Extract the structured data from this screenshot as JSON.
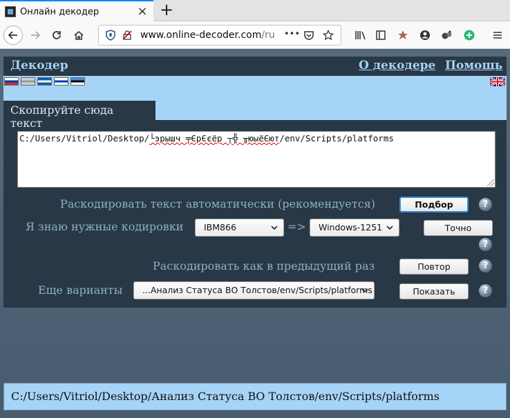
{
  "browser": {
    "tab_title": "Онлайн декодер",
    "tab_close": "×",
    "new_tab": "+",
    "url_host": "www.online-decoder.com",
    "url_path": "/ru",
    "url_more": "•••"
  },
  "header": {
    "title": "Декодер",
    "about_link": "О декодере",
    "help_link": "Помощь"
  },
  "languages": [
    {
      "name": "russian-flag-icon",
      "colors": [
        "#ffffff",
        "#0039a6",
        "#d52b1e"
      ]
    },
    {
      "name": "belarus-flag-icon",
      "colors": [
        "#d0d0d0",
        "#9a9a9a",
        "#d0d0d0"
      ]
    },
    {
      "name": "greek-flag-icon",
      "colors": [
        "#0d5eaf",
        "#ffffff",
        "#0d5eaf"
      ]
    },
    {
      "name": "israel-flag-icon",
      "colors": [
        "#ffffff",
        "#0038b8",
        "#ffffff"
      ]
    },
    {
      "name": "estonia-flag-icon",
      "colors": [
        "#4891d9",
        "#000000",
        "#ffffff"
      ]
    }
  ],
  "input": {
    "tab_label": "Скопируйте сюда текст",
    "text_prefix": "C:/Users/Vitriol/Desktop/",
    "text_garbled": "└эрышч ╤ЄрЄєёр ┬╬ ╥юыёЄют",
    "text_suffix": "/env/Scripts/platforms"
  },
  "rows": {
    "auto_label": "Раскодировать текст автоматически (рекомендуется)",
    "auto_button": "Подбор",
    "known_label": "Я знаю нужные кодировки",
    "source_encoding": "IBM866",
    "arrow": "=>",
    "target_encoding": "Windows-1251",
    "exact_button": "Точно",
    "repeat_label": "Раскодировать как в предыдущий раз",
    "repeat_button": "Повтор",
    "more_label": "Еще варианты",
    "more_value": "...Анализ Статуса ВО Толстов/env/Scripts/platforms",
    "show_button": "Показать",
    "help_glyph": "?"
  },
  "result": {
    "text": "C:/Users/Vitriol/Desktop/Анализ Статуса ВО Толстов/env/Scripts/platforms"
  }
}
